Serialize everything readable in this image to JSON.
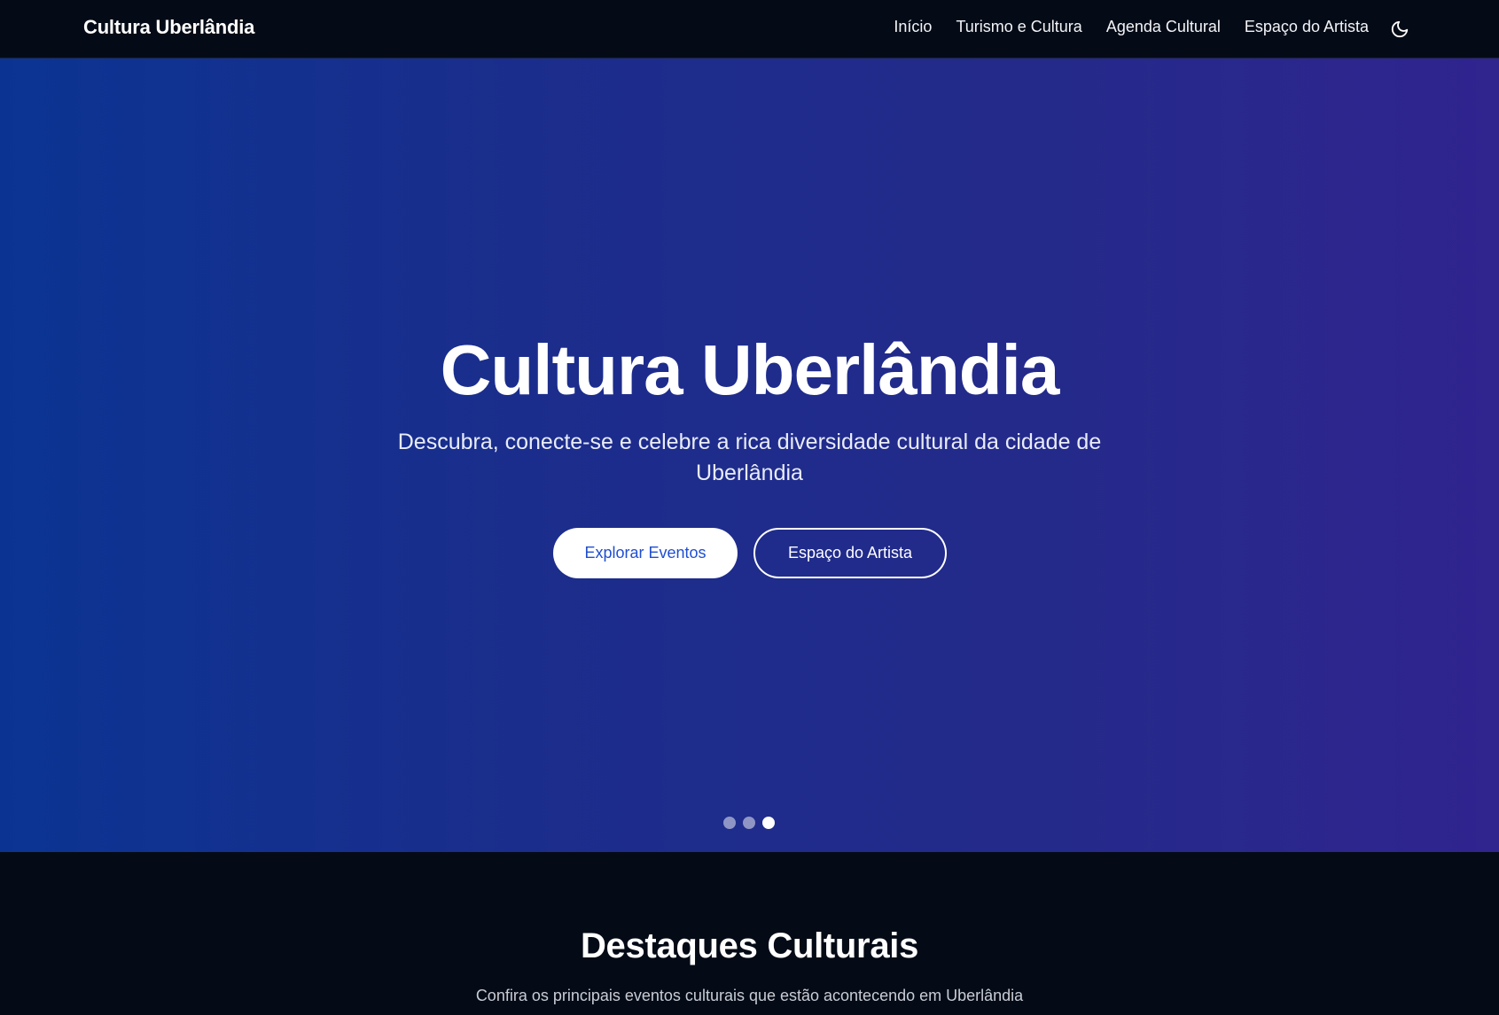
{
  "nav": {
    "brand": "Cultura Uberlândia",
    "links": [
      "Início",
      "Turismo e Cultura",
      "Agenda Cultural",
      "Espaço do Artista"
    ],
    "theme_toggle_icon": "moon-icon"
  },
  "hero": {
    "title": "Cultura Uberlândia",
    "subtitle": "Descubra, conecte-se e celebre a rica diversidade cultural da cidade de Uberlândia",
    "primary_button": "Explorar Eventos",
    "secondary_button": "Espaço do Artista",
    "carousel": {
      "slide_count": 3,
      "active_slide": 3
    }
  },
  "highlights": {
    "title": "Destaques Culturais",
    "subtitle": "Confira os principais eventos culturais que estão acontecendo em Uberlândia"
  },
  "colors": {
    "nav_background": "#050b16",
    "hero_gradient_start": "#0b3492",
    "hero_gradient_end": "#30248f",
    "primary_button_text": "#1f4fd1"
  }
}
